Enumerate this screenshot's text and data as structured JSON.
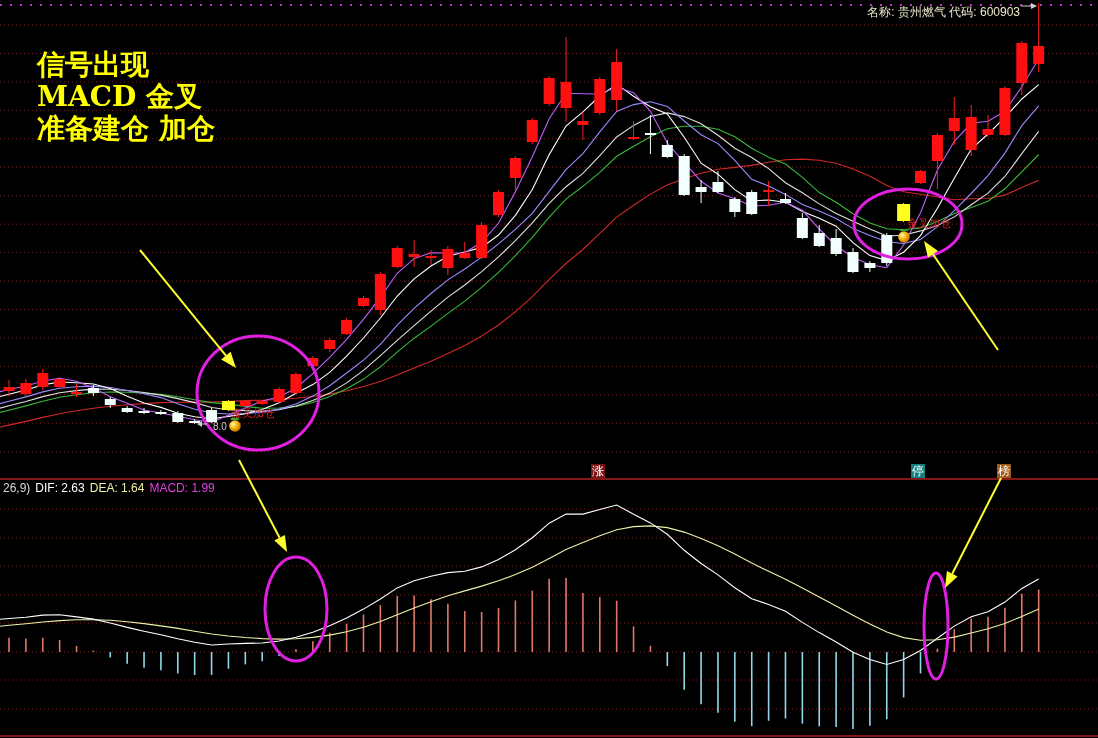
{
  "annotation": {
    "lines": [
      "信号出现",
      "MACD 金叉",
      "准备建仓 加仓"
    ]
  },
  "stock_info": "名称: 贵州燃气 代码: 600903",
  "price_chart": {
    "signals": [
      {
        "label": "金叉加仓"
      },
      {
        "label": "金叉加仓"
      }
    ],
    "low_price_label": "8.0"
  },
  "event_tags": [
    {
      "text": "涨",
      "color": "#7c1414"
    },
    {
      "text": "停",
      "color": "#138080"
    },
    {
      "text": "榜",
      "color": "#9c5a14"
    }
  ],
  "macd_panel": {
    "params": "26,9)",
    "legend": [
      {
        "label": "DIF: 2.63",
        "color": "#ffffff"
      },
      {
        "label": "DEA: 1.64",
        "color": "#f0f0a8"
      },
      {
        "label": "MACD: 1.99",
        "color": "#e040e0"
      }
    ]
  }
}
